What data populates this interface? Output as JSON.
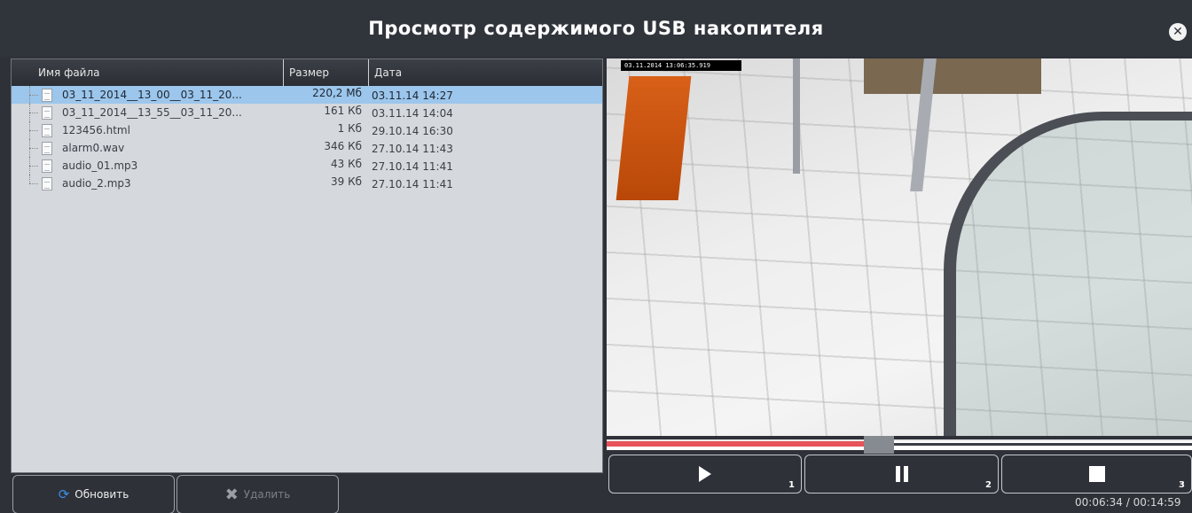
{
  "window": {
    "title": "Просмотр содержимого USB накопителя",
    "close_icon": "close-circle-icon"
  },
  "file_list": {
    "columns": {
      "name": "Имя файла",
      "size": "Размер",
      "date": "Дата"
    },
    "rows": [
      {
        "name": "03_11_2014__13_00__03_11_20...",
        "size": "220,2 Мб",
        "date": "03.11.14 14:27",
        "selected": true
      },
      {
        "name": "03_11_2014__13_55__03_11_20...",
        "size": "161 Кб",
        "date": "03.11.14 14:04",
        "selected": false
      },
      {
        "name": "123456.html",
        "size": "1 Кб",
        "date": "29.10.14 16:30",
        "selected": false
      },
      {
        "name": "alarm0.wav",
        "size": "346 Кб",
        "date": "27.10.14 11:43",
        "selected": false
      },
      {
        "name": "audio_01.mp3",
        "size": "43 Кб",
        "date": "27.10.14 11:41",
        "selected": false
      },
      {
        "name": "audio_2.mp3",
        "size": "39 Кб",
        "date": "27.10.14 11:41",
        "selected": false
      }
    ]
  },
  "actions": {
    "refresh_label": "Обновить",
    "refresh_icon": "refresh-icon",
    "delete_label": "Удалить",
    "delete_icon": "delete-x-icon",
    "delete_enabled": false
  },
  "video": {
    "overlay_timestamp": "03.11.2014 13:06:35.919"
  },
  "playback": {
    "progress_fraction": 0.44,
    "play_shortcut": "1",
    "pause_shortcut": "2",
    "stop_shortcut": "3",
    "timecode": "00:06:34 / 00:14:59"
  },
  "colors": {
    "progress_fill": "#e8535a",
    "selection": "#9cc6ec",
    "refresh_icon": "#3a8ee6"
  }
}
